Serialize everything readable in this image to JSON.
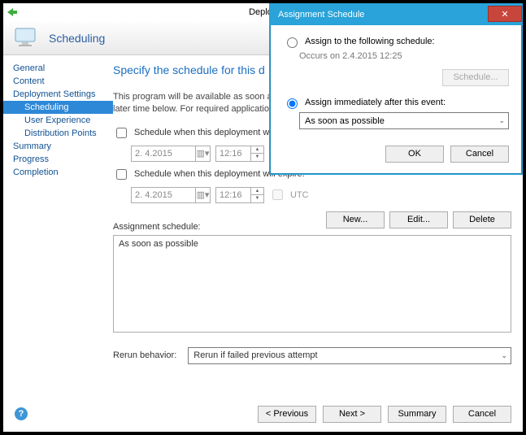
{
  "window_title": "Deploy Soft",
  "header_title": "Scheduling",
  "nav": {
    "items": [
      {
        "label": "General"
      },
      {
        "label": "Content"
      },
      {
        "label": "Deployment Settings"
      },
      {
        "label": "Scheduling",
        "sub": true,
        "sel": true
      },
      {
        "label": "User Experience",
        "sub": true
      },
      {
        "label": "Distribution Points",
        "sub": true
      },
      {
        "label": "Summary"
      },
      {
        "label": "Progress"
      },
      {
        "label": "Completion"
      }
    ]
  },
  "main": {
    "heading": "Specify the schedule for this d",
    "desc": "This program will be available as soon as it\nlater time below. For required applications,",
    "chk_available": "Schedule when this deployment will be",
    "chk_expire": "Schedule when this deployment will expire:",
    "date_val": "2.  4.2015",
    "time_val": "12:16",
    "utc": "UTC",
    "assign_label": "Assignment schedule:",
    "btn_new": "New...",
    "btn_edit": "Edit...",
    "btn_delete": "Delete",
    "list_item": "As soon as possible",
    "rerun_label": "Rerun behavior:",
    "rerun_value": "Rerun if failed previous attempt"
  },
  "footer": {
    "previous": "< Previous",
    "next": "Next >",
    "summary": "Summary",
    "cancel": "Cancel"
  },
  "dialog": {
    "title": "Assignment Schedule",
    "opt1": "Assign to the following schedule:",
    "opt1_sub": "Occurs on 2.4.2015 12:25",
    "schedule_btn": "Schedule...",
    "opt2": "Assign immediately after this event:",
    "combo_value": "As soon as possible",
    "ok": "OK",
    "cancel": "Cancel"
  }
}
